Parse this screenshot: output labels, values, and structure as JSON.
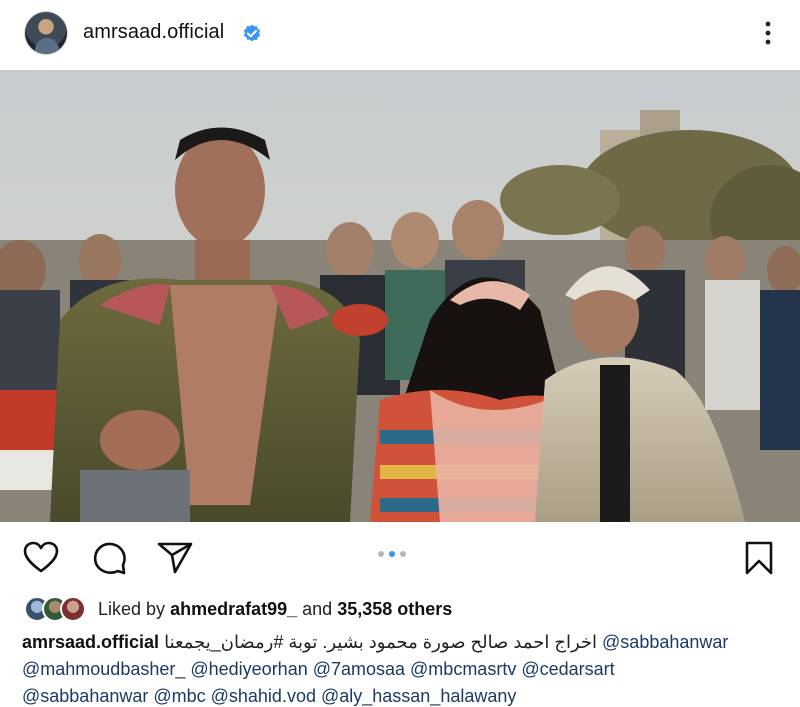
{
  "post": {
    "username": "amrsaad.official",
    "verified": true
  },
  "carousel": {
    "count": 3,
    "active_index": 1
  },
  "likes": {
    "prefix": "Liked by",
    "user": "ahmedrafat99_",
    "middle": "and",
    "count_text": "35,358 others"
  },
  "caption": {
    "username": "amrsaad.official",
    "line1_text": "اخراج احمد صالح  صورة محمود بشير.  توبة #رمضان_يجمعنا",
    "line1_tag": "@sabbahanwar",
    "line2": "@mahmoudbasher_ @hediyeorhan @7amosaa @mbcmasrtv @cedarsart",
    "line3": "@sabbahanwar @mbc @shahid.vod  @aly_hassan_halawany"
  },
  "icons": {
    "verified": "verified-badge-icon",
    "more": "more-options-icon",
    "like": "heart-icon",
    "comment": "comment-icon",
    "share": "send-icon",
    "save": "bookmark-icon"
  },
  "colors": {
    "verified_blue": "#3897f0",
    "link": "#1b3a67"
  }
}
